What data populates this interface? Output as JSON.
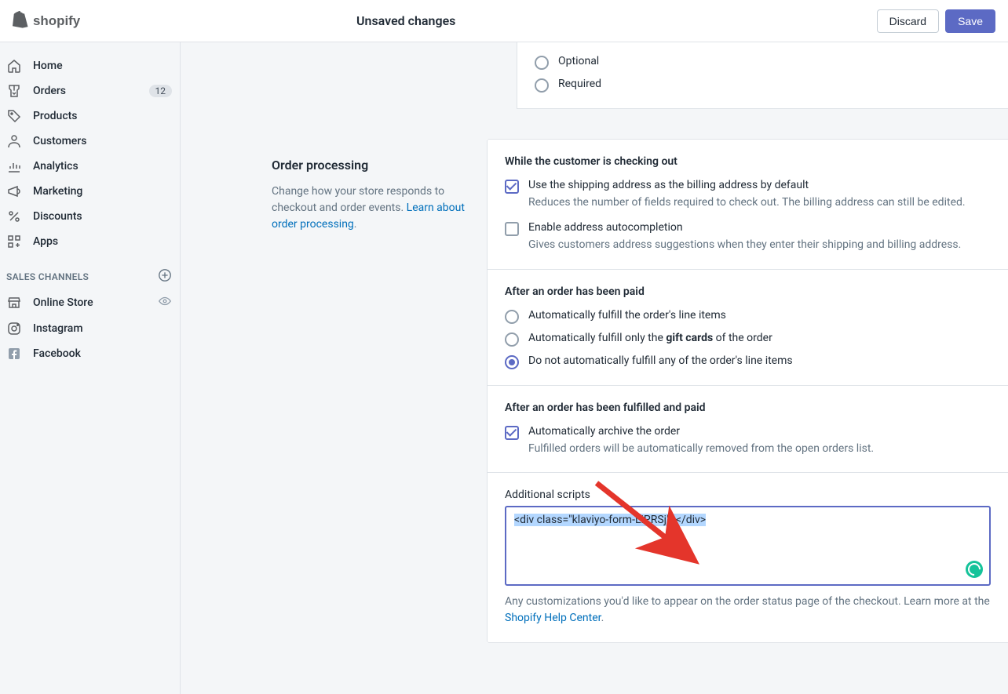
{
  "topbar": {
    "unsaved": "Unsaved changes",
    "discard": "Discard",
    "save": "Save"
  },
  "sidebar": {
    "items": [
      {
        "label": "Home"
      },
      {
        "label": "Orders",
        "badge": "12"
      },
      {
        "label": "Products"
      },
      {
        "label": "Customers"
      },
      {
        "label": "Analytics"
      },
      {
        "label": "Marketing"
      },
      {
        "label": "Discounts"
      },
      {
        "label": "Apps"
      }
    ],
    "channels_title": "SALES CHANNELS",
    "channels": [
      {
        "label": "Online Store"
      },
      {
        "label": "Instagram"
      },
      {
        "label": "Facebook"
      }
    ]
  },
  "toprow": {
    "optional": "Optional",
    "required": "Required"
  },
  "order_processing": {
    "title": "Order processing",
    "desc_pre": "Change how your store responds to checkout and order events. ",
    "link": "Learn about order processing",
    "period": "."
  },
  "checkout": {
    "title": "While the customer is checking out",
    "opt1_label": "Use the shipping address as the billing address by default",
    "opt1_help": "Reduces the number of fields required to check out. The billing address can still be edited.",
    "opt2_label": "Enable address autocompletion",
    "opt2_help": "Gives customers address suggestions when they enter their shipping and billing address."
  },
  "paid": {
    "title": "After an order has been paid",
    "r1": "Automatically fulfill the order's line items",
    "r2_pre": "Automatically fulfill only the ",
    "r2_bold": "gift cards",
    "r2_post": " of the order",
    "r3": "Do not automatically fulfill any of the order's line items"
  },
  "fulfilled": {
    "title": "After an order has been fulfilled and paid",
    "c1_label": "Automatically archive the order",
    "c1_help": "Fulfilled orders will be automatically removed from the open orders list."
  },
  "scripts": {
    "label": "Additional scripts",
    "value": "<div class=\"klaviyo-form-LiPRSj\"></div>",
    "help_pre": "Any customizations you'd like to appear on the order status page of the checkout. Learn more at the ",
    "help_link": "Shopify Help Center",
    "help_post": "."
  }
}
